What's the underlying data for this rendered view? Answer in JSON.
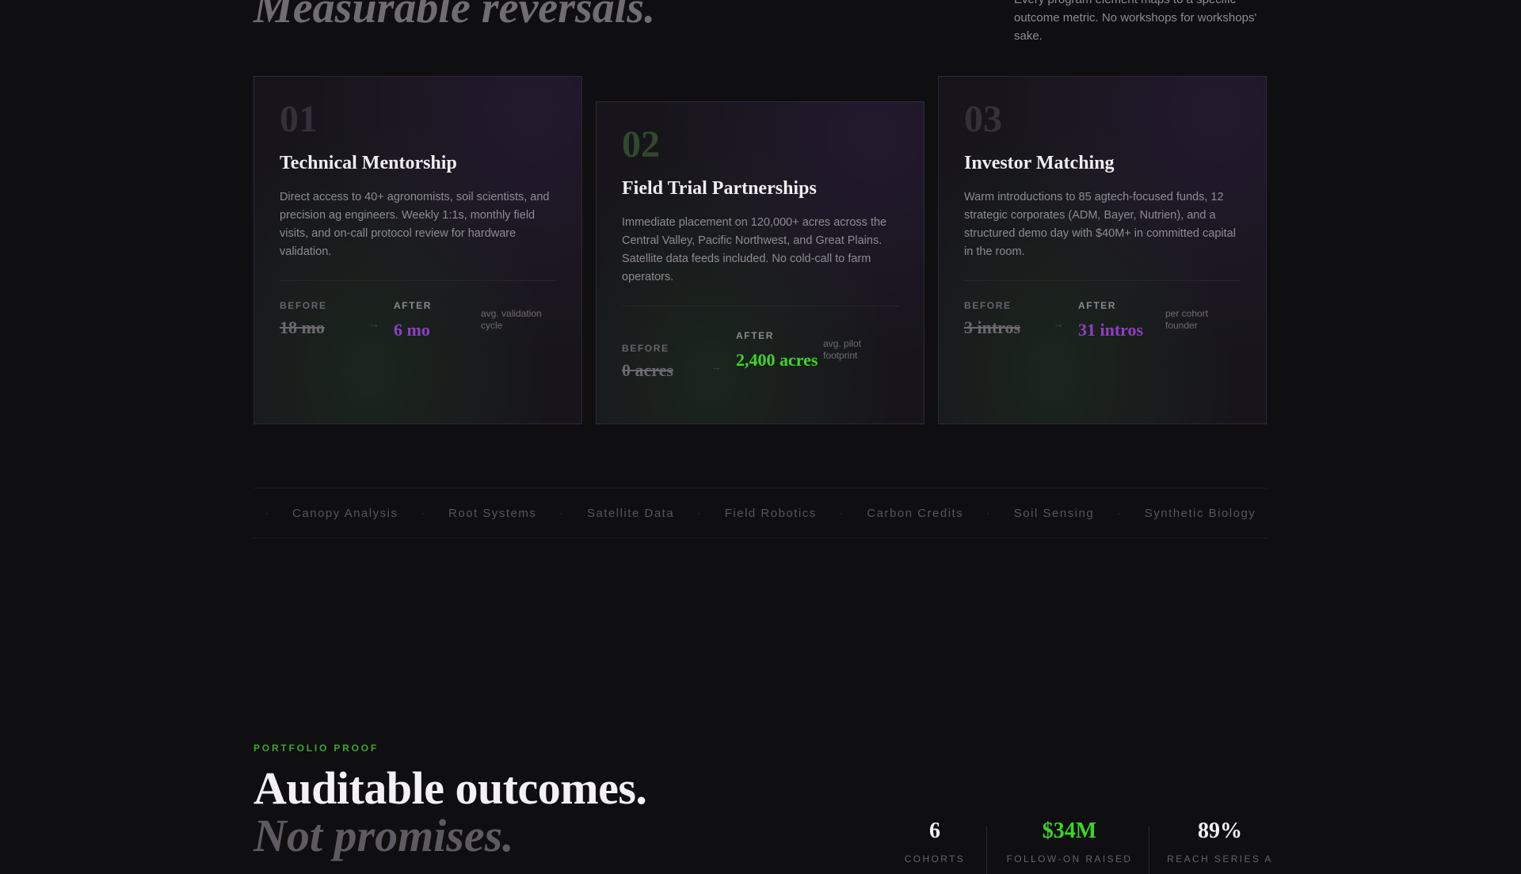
{
  "header": {
    "headline": "Measurable reversals.",
    "intro": "Every program element maps to a specific outcome metric. No workshops for workshops' sake."
  },
  "cards": [
    {
      "number": "01",
      "title": "Technical Mentorship",
      "description": "Direct access to 40+ agronomists, soil scientists, and precision ag engineers. Weekly 1:1s, monthly field visits, and on-call protocol review for hardware validation.",
      "before_label": "BEFORE",
      "before_value": "18 mo",
      "after_label": "AFTER",
      "after_value": "6 mo",
      "after_color": "#8e3fc4",
      "note": "avg. validation cycle"
    },
    {
      "number": "02",
      "title": "Field Trial Partnerships",
      "description": "Immediate placement on 120,000+ acres across the Central Valley, Pacific Northwest, and Great Plains. Satellite data feeds included. No cold-call to farm operators.",
      "before_label": "BEFORE",
      "before_value": "0 acres",
      "after_label": "AFTER",
      "after_value": "2,400 acres",
      "after_color": "#3fd428",
      "note": "avg. pilot footprint"
    },
    {
      "number": "03",
      "title": "Investor Matching",
      "description": "Warm introductions to 85 agtech-focused funds, 12 strategic corporates (ADM, Bayer, Nutrien), and a structured demo day with $40M+ in committed capital in the room.",
      "before_label": "BEFORE",
      "before_value": "3 intros",
      "after_label": "AFTER",
      "after_value": "31 intros",
      "after_color": "#8e3fc4",
      "note": "per cohort founder"
    }
  ],
  "arrow_glyph": "→",
  "ticker": {
    "separator": "·",
    "items": [
      "Canopy Analysis",
      "Root Systems",
      "Satellite Data",
      "Field Robotics",
      "Carbon Credits",
      "Soil Sensing",
      "Synthetic Biology"
    ]
  },
  "portfolio": {
    "eyebrow": "PORTFOLIO PROOF",
    "headline_1": "Auditable outcomes.",
    "headline_2": "Not promises.",
    "stats": [
      {
        "value": "6",
        "label": "COHORTS",
        "color": "#f3f1f4"
      },
      {
        "value": "$34M",
        "label": "FOLLOW-ON RAISED",
        "color": "#3fd428"
      },
      {
        "value": "89%",
        "label": "REACH SERIES A",
        "color": "#f3f1f4"
      }
    ]
  }
}
